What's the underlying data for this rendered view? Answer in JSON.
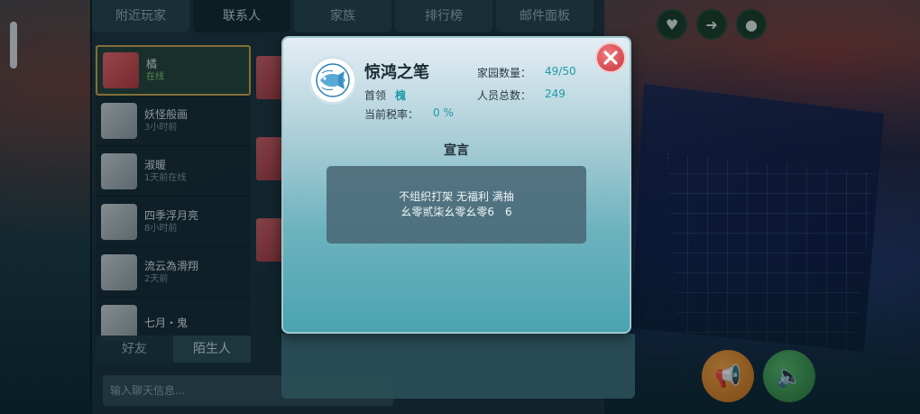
{
  "background": {
    "top_tabs": [
      {
        "label": "附近玩家",
        "active": false
      },
      {
        "label": "联系人",
        "active": true
      },
      {
        "label": "家族",
        "active": false
      },
      {
        "label": "排行榜",
        "active": false
      },
      {
        "label": "邮件面板",
        "active": false
      }
    ],
    "contacts": [
      {
        "name": "橘",
        "status": "在线",
        "selected": true,
        "avatar": "red"
      },
      {
        "name": "妖怪般画",
        "status": "3小时前",
        "selected": false,
        "avatar": "grey"
      },
      {
        "name": "淑暖",
        "status": "1天前在线",
        "selected": false,
        "avatar": "grey"
      },
      {
        "name": "四季浮月亮",
        "status": "8小时前",
        "selected": false,
        "avatar": "grey"
      },
      {
        "name": "流云為滑翔",
        "status": "2天前",
        "selected": false,
        "avatar": "grey"
      },
      {
        "name": "七月・鬼",
        "status": "",
        "selected": false,
        "avatar": "grey"
      }
    ],
    "bottom_tabs": [
      {
        "label": "好友",
        "active": false
      },
      {
        "label": "陌生人",
        "active": true
      }
    ],
    "chat_placeholder": "输入聊天信息..."
  },
  "dialog": {
    "guild_name": "惊鸿之笔",
    "leader_label": "首领",
    "leader_value": "槐",
    "tax_label": "当前税率：",
    "tax_value": "0 %",
    "homes_label": "家园数量：",
    "homes_value": "49/50",
    "members_label": "人员总数：",
    "members_value": "249",
    "declaration_title": "宣言",
    "declaration_lines": [
      "不组织打架 无福利 满抽",
      "幺零贰柒幺零幺零6　6"
    ],
    "emblem_icon": "fish-icon",
    "close_icon": "close-icon"
  },
  "colors": {
    "accent": "#1f9aa8",
    "close_red": "#c8343c",
    "selected_border": "#c8a64a"
  }
}
